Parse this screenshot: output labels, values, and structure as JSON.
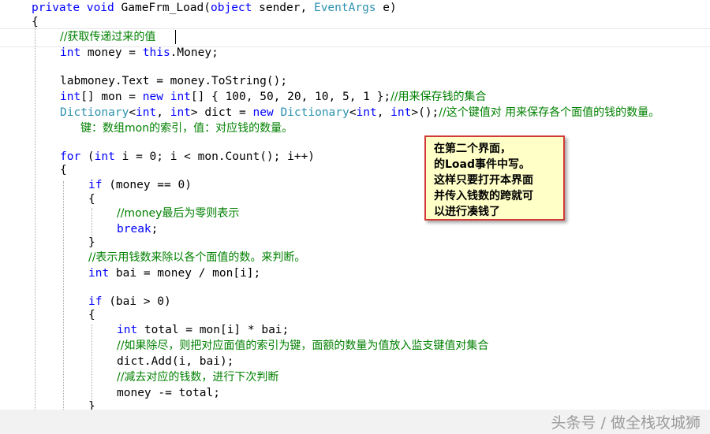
{
  "code": {
    "line01": {
      "kw1": "private",
      "kw2": "void",
      "name": "GameFrm_Load(",
      "ty1": "object",
      "mid": " sender, ",
      "ty2": "EventArgs",
      "end": " e)"
    },
    "line02": {
      "text": "{"
    },
    "line03": {
      "comment": "//获取传递过来的值"
    },
    "line04": {
      "kw1": "int",
      "mid": " money = ",
      "kw2": "this",
      "end": ".Money;"
    },
    "line05": {
      "text": "labmoney.Text = money.ToString();"
    },
    "line06": {
      "kw1": "int",
      "a": "[] mon = ",
      "kw2": "new",
      "sp": " ",
      "kw3": "int",
      "b": "[] { 100, 50, 20, 10, 5, 1 };",
      "comment": "//用来保存钱的集合"
    },
    "line07": {
      "ty1": "Dictionary",
      "a": "<",
      "kw1": "int",
      "b": ", ",
      "kw2": "int",
      "c": "> dict = ",
      "kw3": "new",
      "sp": " ",
      "ty2": "Dictionary",
      "d": "<",
      "kw4": "int",
      "e": ", ",
      "kw5": "int",
      "f": ">();",
      "comment": "//这个键值对 用来保存各个面值的钱的数量。"
    },
    "line08": {
      "comment": "键：数组mon的索引，值：对应钱的数量。"
    },
    "line09": {
      "kw1": "for",
      "a": " (",
      "kw2": "int",
      "b": " i = 0; i < mon.Count(); i++)"
    },
    "line10": {
      "text": "{"
    },
    "line11": {
      "kw1": "if",
      "a": " (money == 0)"
    },
    "line12": {
      "text": "{"
    },
    "line13": {
      "comment": "//money最后为零则表示"
    },
    "line14": {
      "kw1": "break",
      "a": ";"
    },
    "line15": {
      "text": "}"
    },
    "line16": {
      "comment": "//表示用钱数来除以各个面值的数。来判断。"
    },
    "line17": {
      "kw1": "int",
      "a": " bai = money / mon[i];"
    },
    "line18": {
      "kw1": "if",
      "a": " (bai > 0)"
    },
    "line19": {
      "text": "{"
    },
    "line20": {
      "kw1": "int",
      "a": " total = mon[i] * bai;"
    },
    "line21": {
      "comment": "//如果除尽，则把对应面值的索引为键，面额的数量为值放入监支键值对集合"
    },
    "line22": {
      "text": "dict.Add(i, bai);"
    },
    "line23": {
      "comment": "//减去对应的钱数，进行下次判断"
    },
    "line24": {
      "text": "money -= total;"
    },
    "line25": {
      "text": "}"
    }
  },
  "note": {
    "lines": [
      "在第二个界面，",
      "的Load事件中写。",
      "这样只要打开本界面",
      "并传入钱数的跨就可",
      "以进行凑钱了"
    ]
  },
  "watermark": "头条号 / 做全栈攻城狮"
}
